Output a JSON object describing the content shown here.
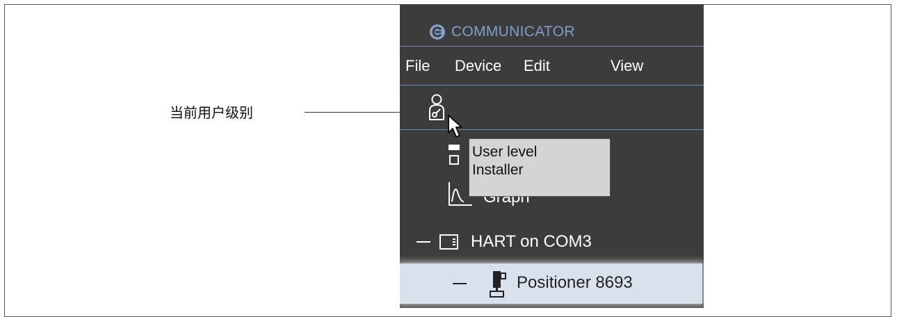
{
  "annotation": {
    "label": "当前用户级别"
  },
  "app": {
    "title": "COMMUNICATOR",
    "logo_icon": "communicator-logo-icon",
    "accent_color": "#7e9fca"
  },
  "menu": {
    "items": [
      "File",
      "Device",
      "Edit",
      "View"
    ]
  },
  "toolbar": {
    "user_level_icon": "user-key-icon"
  },
  "tooltip": {
    "title": "User level",
    "value": "Installer"
  },
  "tree": {
    "graph_label": "Graph",
    "hart_label": "HART on COM3",
    "positioner_label": "Positioner 8693"
  }
}
